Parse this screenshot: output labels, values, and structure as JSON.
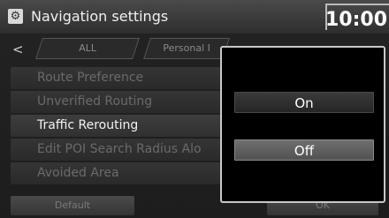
{
  "header": {
    "title": "Navigation settings",
    "time": "10:00",
    "settings_icon": "gear-icon"
  },
  "tabs": {
    "back_icon": "chevron-left-icon",
    "items": [
      {
        "label": "ALL"
      },
      {
        "label": "Personal I"
      }
    ]
  },
  "list": {
    "items": [
      {
        "label": "Route Preference",
        "enabled": false
      },
      {
        "label": "Unverified Routing",
        "enabled": false
      },
      {
        "label": "Traffic Rerouting",
        "enabled": true
      },
      {
        "label": "Edit POI Search Radius Alo",
        "enabled": false
      },
      {
        "label": "Avoided Area",
        "enabled": false
      }
    ]
  },
  "buttons": {
    "default_label": "Default",
    "ok_label": "OK"
  },
  "popup": {
    "options": [
      {
        "label": "On",
        "selected": false
      },
      {
        "label": "Off",
        "selected": true
      }
    ]
  }
}
